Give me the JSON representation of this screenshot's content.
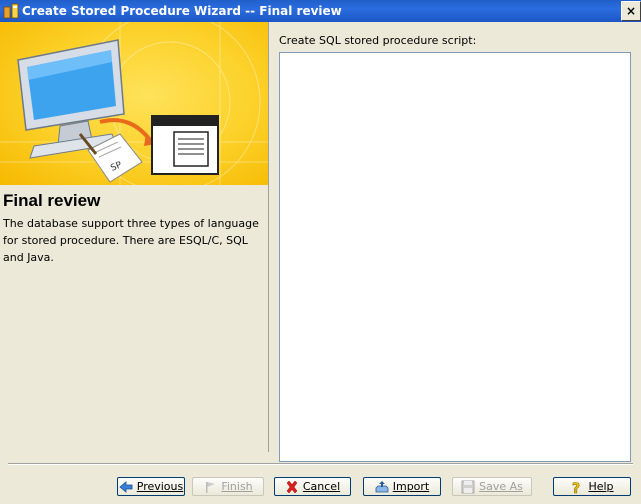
{
  "window": {
    "title": "Create Stored Procedure Wizard -- Final review",
    "close_glyph": "×"
  },
  "left": {
    "banner_tag": "SP",
    "heading": "Final review",
    "description": "The database support three types of language for stored procedure. There are ESQL/C, SQL and Java."
  },
  "right": {
    "script_label": "Create SQL stored procedure script:",
    "script_value": ""
  },
  "buttons": {
    "previous": "Previous",
    "finish": "Finish",
    "cancel": "Cancel",
    "import": "Import",
    "save_as": "Save As",
    "help": "Help"
  },
  "colors": {
    "titlebar": "#2a6ddf",
    "banner": "#fcd22b",
    "dialog_bg": "#ece9d8"
  }
}
